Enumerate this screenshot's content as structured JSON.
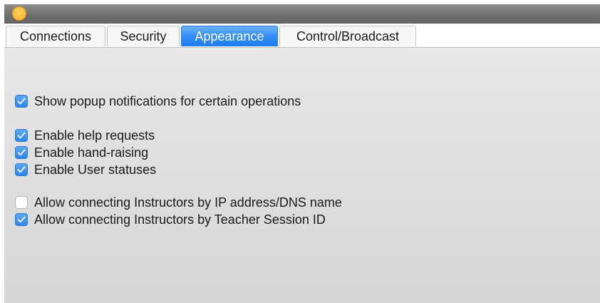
{
  "window": {
    "accent_color": "#2a86f2",
    "titlebar_button": "minimize-button"
  },
  "tabs": [
    {
      "label": "Connections",
      "active": false
    },
    {
      "label": "Security",
      "active": false
    },
    {
      "label": "Appearance",
      "active": true
    },
    {
      "label": "Control/Broadcast",
      "active": false
    }
  ],
  "options": [
    {
      "label": "Show popup notifications for certain operations",
      "checked": true
    },
    {
      "label": "Enable help requests",
      "checked": true
    },
    {
      "label": "Enable hand-raising",
      "checked": true
    },
    {
      "label": "Enable User statuses",
      "checked": true
    },
    {
      "label": "Allow connecting Instructors by IP address/DNS name",
      "checked": false
    },
    {
      "label": "Allow connecting Instructors by Teacher Session ID",
      "checked": true
    }
  ]
}
